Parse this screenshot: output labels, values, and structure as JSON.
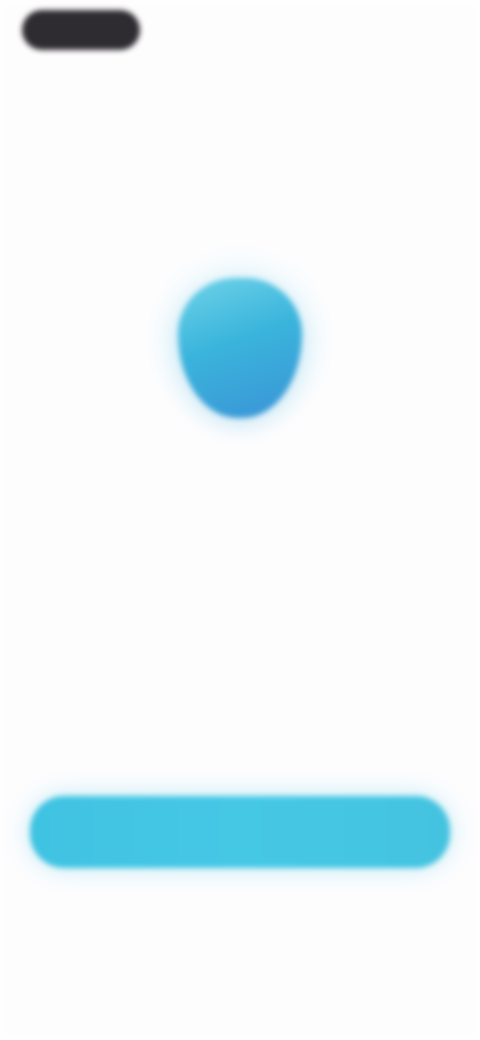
{
  "status_bar": {},
  "brand": {
    "logo_icon": "blue-droplet-icon",
    "name": "",
    "tagline": ""
  },
  "actions": {
    "primary_button_label": "",
    "secondary_link_label": ""
  },
  "colors": {
    "background": "#fefdfe",
    "accent": "#45c8e4",
    "logo_gradient_top": "#6fd3e8",
    "logo_gradient_bottom": "#3a93d6",
    "title_text": "#514e55",
    "muted_text": "#b9b6bd"
  }
}
